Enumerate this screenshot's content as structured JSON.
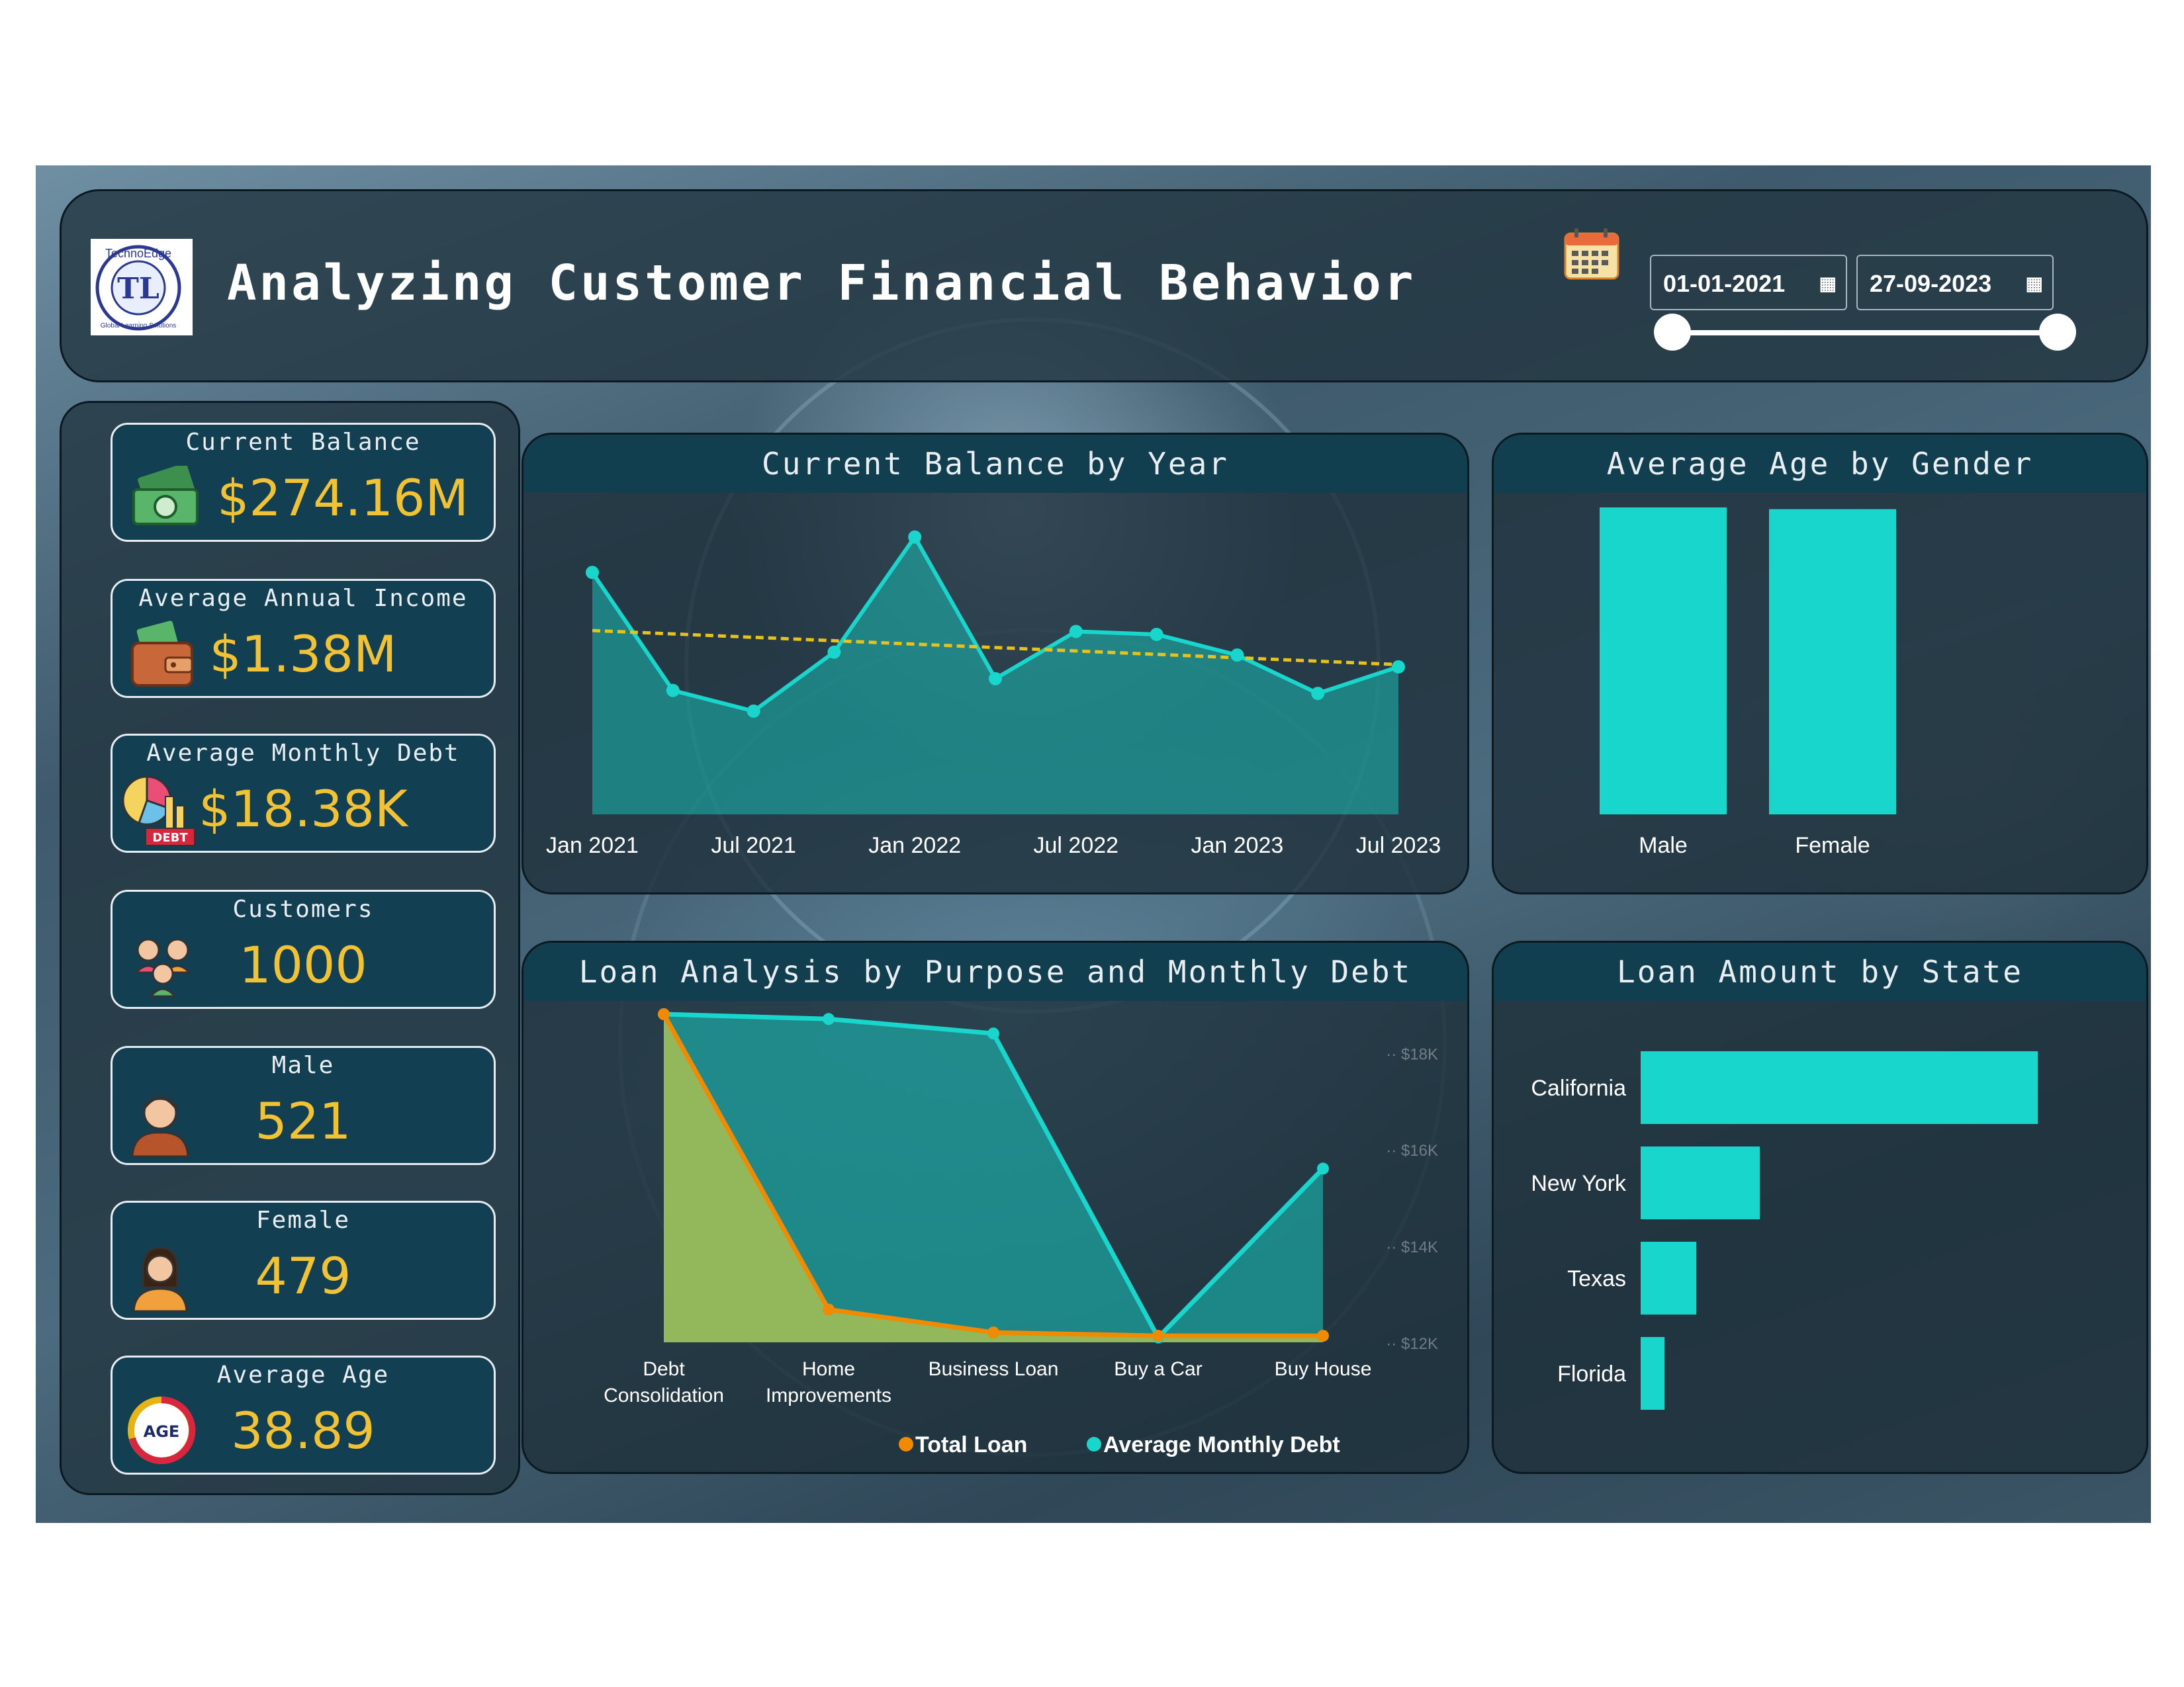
{
  "header": {
    "title": "Analyzing Customer Financial Behavior",
    "logo_text": "TechnoEdge",
    "logo_sub": "Global Learning Solutions",
    "date_start": "01-01-2021",
    "date_end": "27-09-2023"
  },
  "kpis": [
    {
      "label": "Current Balance",
      "value": "$274.16M",
      "icon": "money-icon"
    },
    {
      "label": "Average Annual Income",
      "value": "$1.38M",
      "icon": "wallet-icon"
    },
    {
      "label": "Average Monthly Debt",
      "value": "$18.38K",
      "icon": "debt-chart-icon"
    },
    {
      "label": "Customers",
      "value": "1000",
      "icon": "customers-icon"
    },
    {
      "label": "Male",
      "value": "521",
      "icon": "male-avatar-icon"
    },
    {
      "label": "Female",
      "value": "479",
      "icon": "female-avatar-icon"
    },
    {
      "label": "Average Age",
      "value": "38.89",
      "icon": "age-icon"
    }
  ],
  "icon_badges": {
    "debt": "DEBT",
    "age": "AGE"
  },
  "colors": {
    "teal": "#18d6cc",
    "orange": "#f08a00",
    "olive": "#9abb59",
    "gold": "#f1c233",
    "trend": "#e6c21a"
  },
  "chart_data": [
    {
      "id": "balance_by_year",
      "type": "area",
      "title": "Current Balance by Year",
      "x_ticks": [
        "Jan 2021",
        "Jul 2021",
        "Jan 2022",
        "Jul 2022",
        "Jan 2023",
        "Jul 2023"
      ],
      "x": [
        "2021-01",
        "2021-04",
        "2021-07",
        "2021-10",
        "2022-01",
        "2022-04",
        "2022-07",
        "2022-10",
        "2023-01",
        "2023-04",
        "2023-07"
      ],
      "values": [
        0.82,
        0.42,
        0.35,
        0.55,
        0.94,
        0.46,
        0.62,
        0.61,
        0.54,
        0.41,
        0.5
      ],
      "trendline": true,
      "y_axis_visible": false
    },
    {
      "id": "age_by_gender",
      "type": "bar",
      "title": "Average Age by Gender",
      "categories": [
        "Male",
        "Female"
      ],
      "values": [
        39.0,
        38.78
      ],
      "ylim": [
        0,
        39.0
      ]
    },
    {
      "id": "loan_by_purpose",
      "type": "area",
      "title": "Loan Analysis by Purpose and Monthly Debt",
      "categories": [
        "Debt Consolidation",
        "Home Improvements",
        "Business Loan",
        "Buy a Car",
        "Buy House"
      ],
      "series": [
        {
          "name": "Total Loan",
          "values": [
            1.0,
            0.1,
            0.03,
            0.02,
            0.02
          ]
        },
        {
          "name": "Average Monthly Debt",
          "values": [
            18.8,
            18.7,
            18.4,
            12.1,
            15.6
          ]
        }
      ],
      "secondary_ticks": [
        "$18K",
        "$16K",
        "$14K",
        "$12K"
      ],
      "secondary_ylim": [
        12,
        18.8
      ],
      "legend": "bottom"
    },
    {
      "id": "loan_by_state",
      "type": "bar",
      "orientation": "horizontal",
      "title": "Loan Amount by State",
      "categories": [
        "California",
        "New York",
        "Texas",
        "Florida"
      ],
      "values": [
        100,
        30,
        14,
        6
      ]
    }
  ]
}
